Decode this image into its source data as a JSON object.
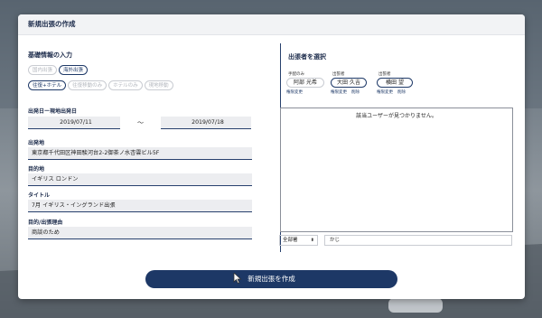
{
  "modal": {
    "title": "新規出張の作成"
  },
  "basic": {
    "title": "基礎情報の入力",
    "scope_chips": [
      {
        "label": "国内出張",
        "active": false
      },
      {
        "label": "海外出張",
        "active": true
      }
    ],
    "type_chips": [
      {
        "label": "往復+ホテル",
        "active": true
      },
      {
        "label": "往復移動のみ",
        "active": false
      },
      {
        "label": "ホテルのみ",
        "active": false
      },
      {
        "label": "現地移動",
        "active": false
      }
    ],
    "dates": {
      "label": "出発日ー現地出発日",
      "start": "2019/07/11",
      "tilde": "〜",
      "end": "2019/07/18"
    },
    "origin": {
      "label": "出発地",
      "value": "東京都千代田区神田駿河台2-2御茶ノ水杏雲ビル5F"
    },
    "destination": {
      "label": "目的地",
      "value": "イギリス ロンドン"
    },
    "trip_title": {
      "label": "タイトル",
      "value": "7月 イギリス・イングランド出張"
    },
    "purpose": {
      "label": "目的/出張理由",
      "value": "商談のため"
    }
  },
  "travelers": {
    "title": "出張者を選択",
    "people": [
      {
        "role": "手配のみ",
        "name": "阿部 光希",
        "actions": [
          "権限変更"
        ]
      },
      {
        "role": "出張者",
        "name": "大田 久吉",
        "actions": [
          "権限変更",
          "削除"
        ]
      },
      {
        "role": "出張者",
        "name": "横田 望",
        "actions": [
          "権限変更",
          "削除"
        ]
      }
    ],
    "empty_message": "該当ユーザーが見つかりません。",
    "department_select": "全部署",
    "search_value": "かじ"
  },
  "submit_label": "新規出張を作成"
}
